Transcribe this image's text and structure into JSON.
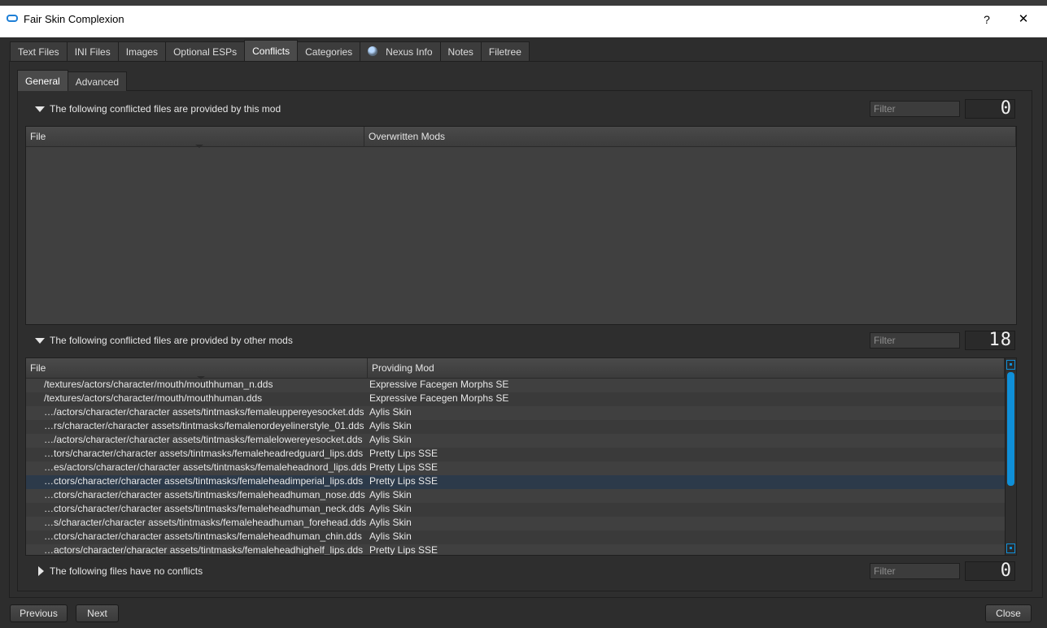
{
  "window": {
    "title": "Fair Skin Complexion",
    "help_label": "?",
    "close_label": "✕"
  },
  "top_tabs": [
    "Text Files",
    "INI Files",
    "Images",
    "Optional ESPs",
    "Conflicts",
    "Categories",
    "Nexus Info",
    "Notes",
    "Filetree"
  ],
  "active_top_tab": "Conflicts",
  "sub_tabs": [
    "General",
    "Advanced"
  ],
  "active_sub_tab": "General",
  "section_provided_by_this_mod": {
    "label": "The following conflicted files are provided by this mod",
    "filter_placeholder": "Filter",
    "count": "0",
    "columns": [
      "File",
      "Overwritten Mods"
    ],
    "rows": []
  },
  "section_provided_by_other_mods": {
    "label": "The following conflicted files are provided by other mods",
    "filter_placeholder": "Filter",
    "count": "18",
    "columns": [
      "File",
      "Providing Mod"
    ],
    "rows": [
      [
        "/textures/actors/character/mouth/mouthhuman_n.dds",
        "Expressive Facegen Morphs SE"
      ],
      [
        "/textures/actors/character/mouth/mouthhuman.dds",
        "Expressive Facegen Morphs SE"
      ],
      [
        "…/actors/character/character assets/tintmasks/femaleuppereyesocket.dds",
        "Aylis Skin"
      ],
      [
        "…rs/character/character assets/tintmasks/femalenordeyelinerstyle_01.dds",
        "Aylis Skin"
      ],
      [
        "…/actors/character/character assets/tintmasks/femalelowereyesocket.dds",
        "Aylis Skin"
      ],
      [
        "…tors/character/character assets/tintmasks/femaleheadredguard_lips.dds",
        "Pretty Lips SSE"
      ],
      [
        "…es/actors/character/character assets/tintmasks/femaleheadnord_lips.dds",
        "Pretty Lips SSE"
      ],
      [
        "…ctors/character/character assets/tintmasks/femaleheadimperial_lips.dds",
        "Pretty Lips SSE"
      ],
      [
        "…ctors/character/character assets/tintmasks/femaleheadhuman_nose.dds",
        "Aylis Skin"
      ],
      [
        "…ctors/character/character assets/tintmasks/femaleheadhuman_neck.dds",
        "Aylis Skin"
      ],
      [
        "…s/character/character assets/tintmasks/femaleheadhuman_forehead.dds",
        "Aylis Skin"
      ],
      [
        "…ctors/character/character assets/tintmasks/femaleheadhuman_chin.dds",
        "Aylis Skin"
      ],
      [
        "…actors/character/character assets/tintmasks/femaleheadhighelf_lips.dds",
        "Pretty Lips SSE"
      ]
    ],
    "selected_row": 7
  },
  "section_no_conflicts": {
    "label": "The following files have no conflicts",
    "filter_placeholder": "Filter",
    "count": "0"
  },
  "buttons": {
    "previous": "Previous",
    "next": "Next",
    "close": "Close"
  },
  "colors": {
    "accent": "#0f8fd8",
    "background": "#2d2d2d"
  }
}
